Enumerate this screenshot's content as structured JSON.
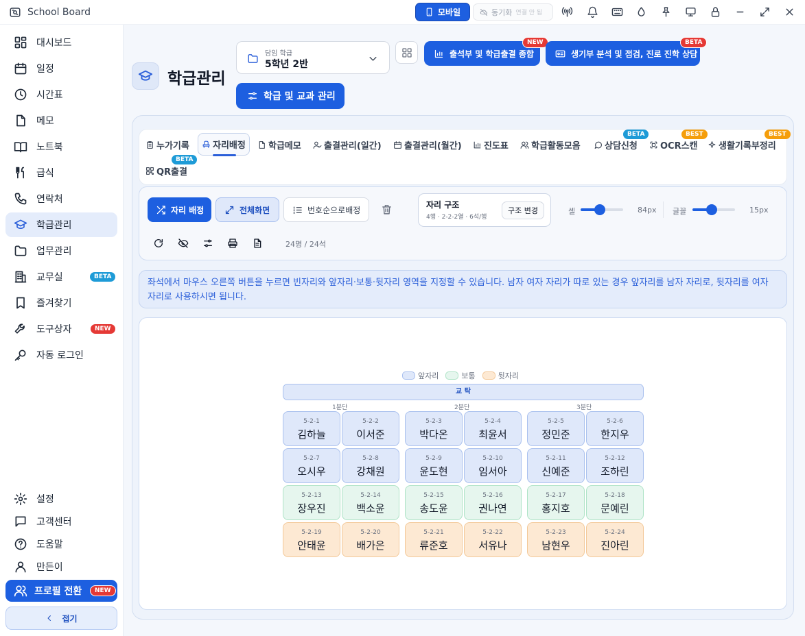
{
  "app": {
    "title": "School Board"
  },
  "titlebar": {
    "mobile_label": "모바일",
    "sync_label": "동기화",
    "sync_status": "연결 안 됨"
  },
  "sidebar": {
    "items": [
      {
        "label": "대시보드",
        "icon": "dashboard-icon"
      },
      {
        "label": "일정",
        "icon": "calendar-icon"
      },
      {
        "label": "시간표",
        "icon": "clock-icon"
      },
      {
        "label": "메모",
        "icon": "memo-icon"
      },
      {
        "label": "노트북",
        "icon": "book-icon"
      },
      {
        "label": "급식",
        "icon": "utensils-icon"
      },
      {
        "label": "연락처",
        "icon": "phone-icon"
      },
      {
        "label": "학급관리",
        "icon": "graduation-cap-icon",
        "active": true
      },
      {
        "label": "업무관리",
        "icon": "folder-icon"
      },
      {
        "label": "교무실",
        "icon": "building-icon",
        "badge": "BETA"
      },
      {
        "label": "즐겨찾기",
        "icon": "bookmark-icon"
      },
      {
        "label": "도구상자",
        "icon": "wrench-icon",
        "badge": "NEW"
      },
      {
        "label": "자동 로그인",
        "icon": "key-icon"
      }
    ],
    "bottom": [
      {
        "label": "설정",
        "icon": "gear-icon"
      },
      {
        "label": "고객센터",
        "icon": "chat-icon"
      },
      {
        "label": "도움말",
        "icon": "help-icon"
      },
      {
        "label": "만든이",
        "icon": "user-icon"
      }
    ],
    "profile_label": "프로필 전환",
    "profile_badge": "NEW",
    "fold_label": "접기"
  },
  "header": {
    "title": "학급관리",
    "class_select_label": "담임 학급",
    "class_select_value": "5학년 2반",
    "btn_attendance": "출석부 및 학급출결 종합",
    "btn_attendance_badge": "NEW",
    "btn_record": "생기부 분석 및 점검, 진로 진학 상담",
    "btn_record_badge": "BETA",
    "btn_manage": "학급 및 교과 관리"
  },
  "tabs": [
    {
      "label": "누가기록",
      "icon": "clipboard-icon"
    },
    {
      "label": "자리배정",
      "icon": "seat-icon",
      "active": true
    },
    {
      "label": "학급메모",
      "icon": "file-icon"
    },
    {
      "label": "출결관리(일간)",
      "icon": "user-check-icon"
    },
    {
      "label": "출결관리(월간)",
      "icon": "calendar-icon"
    },
    {
      "label": "진도표",
      "icon": "bar-chart-icon"
    },
    {
      "label": "학급활동모음",
      "icon": "users-icon"
    },
    {
      "label": "상담신청",
      "icon": "message-icon",
      "badge": "BETA"
    },
    {
      "label": "OCR스캔",
      "icon": "scan-icon",
      "badge": "BEST"
    },
    {
      "label": "생활기록부정리",
      "icon": "sparkle-icon",
      "badge": "BEST"
    },
    {
      "label": "QR출결",
      "icon": "qr-icon",
      "badge": "BETA"
    }
  ],
  "toolbar": {
    "seat_assign": "자리 배정",
    "fullscreen": "전체화면",
    "by_number": "번호순으로배정",
    "structure_title": "자리 구조",
    "structure_desc": "4행 · 2-2-2열 · 6석/행",
    "structure_change": "구조 변경",
    "cell_label": "셀",
    "cell_value": "84px",
    "cell_fraction": 0.45,
    "font_label": "글꼴",
    "font_value": "15px",
    "font_fraction": 0.45,
    "count": "24명 / 24석"
  },
  "notice": "좌석에서 마우스 오른쪽 버튼을 누르면 빈자리와 앞자리·보통·뒷자리 영역을 지정할 수 있습니다. 남자 여자 자리가 따로 있는 경우 앞자리를 남자 자리로, 뒷자리를 여자 자리로 사용하시면 됩니다.",
  "seating": {
    "legend": {
      "front": "앞자리",
      "mid": "보통",
      "back": "뒷자리"
    },
    "colors": {
      "front": "#dfe8fa",
      "mid": "#e6f6ee",
      "back": "#fde9d3"
    },
    "podium": "교 탁",
    "sections": [
      "1분단",
      "2분단",
      "3분단"
    ],
    "rows": [
      {
        "zone": "front",
        "seats": [
          {
            "num": "5-2-1",
            "name": "김하늘"
          },
          {
            "num": "5-2-2",
            "name": "이서준"
          },
          {
            "num": "5-2-3",
            "name": "박다온"
          },
          {
            "num": "5-2-4",
            "name": "최윤서"
          },
          {
            "num": "5-2-5",
            "name": "정민준"
          },
          {
            "num": "5-2-6",
            "name": "한지우"
          }
        ]
      },
      {
        "zone": "front",
        "seats": [
          {
            "num": "5-2-7",
            "name": "오시우"
          },
          {
            "num": "5-2-8",
            "name": "강채원"
          },
          {
            "num": "5-2-9",
            "name": "윤도현"
          },
          {
            "num": "5-2-10",
            "name": "임서아"
          },
          {
            "num": "5-2-11",
            "name": "신예준"
          },
          {
            "num": "5-2-12",
            "name": "조하린"
          }
        ]
      },
      {
        "zone": "mid",
        "seats": [
          {
            "num": "5-2-13",
            "name": "장우진"
          },
          {
            "num": "5-2-14",
            "name": "백소윤"
          },
          {
            "num": "5-2-15",
            "name": "송도윤"
          },
          {
            "num": "5-2-16",
            "name": "권나연"
          },
          {
            "num": "5-2-17",
            "name": "홍지호"
          },
          {
            "num": "5-2-18",
            "name": "문예린"
          }
        ]
      },
      {
        "zone": "back",
        "seats": [
          {
            "num": "5-2-19",
            "name": "안태윤"
          },
          {
            "num": "5-2-20",
            "name": "배가은"
          },
          {
            "num": "5-2-21",
            "name": "류준호"
          },
          {
            "num": "5-2-22",
            "name": "서유나"
          },
          {
            "num": "5-2-23",
            "name": "남현우"
          },
          {
            "num": "5-2-24",
            "name": "진아린"
          }
        ]
      }
    ]
  }
}
